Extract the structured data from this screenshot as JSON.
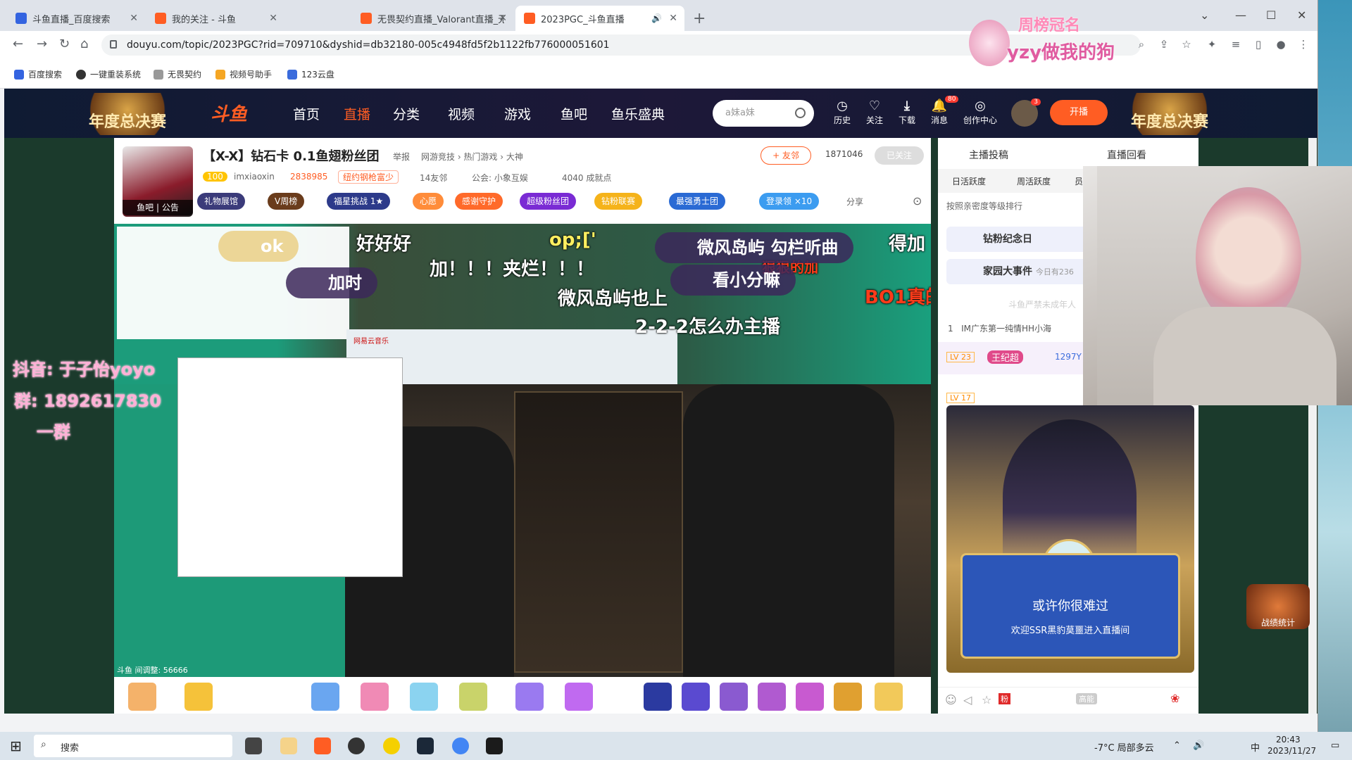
{
  "browser": {
    "tabs": [
      {
        "title": "斗鱼直播_百度搜索",
        "fav": "#3464e0"
      },
      {
        "title": "我的关注 - 斗鱼",
        "fav": "#ff5d23"
      },
      {
        "title": "无畏契约直播_Valorant直播_无",
        "fav": "#ff5d23"
      },
      {
        "title": "2023PGC_斗鱼直播",
        "fav": "#ff5d23"
      }
    ],
    "new_tab": "+",
    "url": "douyu.com/topic/2023PGC?rid=709710&dyshid=db32180-005c4948fd5f2b1122fb776000051601",
    "bookmarks": [
      "百度搜索",
      "一键重装系统",
      "无畏契约",
      "视频号助手",
      "123云盘"
    ],
    "overlay_text": "yzy做我的狗",
    "overlay_top": "周榜冠名"
  },
  "header": {
    "logo": "斗鱼",
    "nav": [
      "首页",
      "直播",
      "分类",
      "视频",
      "游戏",
      "鱼吧",
      "鱼乐盛典"
    ],
    "search_placeholder": "a妹a妹",
    "icons": [
      {
        "label": "历史",
        "glyph": "◷"
      },
      {
        "label": "关注",
        "glyph": "♡"
      },
      {
        "label": "下载",
        "glyph": "⤓"
      },
      {
        "label": "消息",
        "glyph": "🔔"
      },
      {
        "label": "创作中心",
        "glyph": "◎"
      }
    ],
    "msg_count": "80",
    "avatar_count": "3",
    "start_live": "开播",
    "banner": "年度总决赛"
  },
  "room": {
    "title": "【X-X】钻石卡 0.1鱼翅粉丝团",
    "report": "举报",
    "category": "网游竞技 › 热门游戏 › 大神",
    "level": "100",
    "streamer": "imxiaoxin",
    "heat": "2838985",
    "badge": "纽约钢枪富少",
    "friends": "14友邻",
    "guild": "公会: 小象互娱",
    "achievements": "4040 成就点",
    "follow": "+ 友邻",
    "follow_count": "1871046",
    "followed": "已关注",
    "fishbar": "鱼吧 | 公告",
    "tags": [
      "礼物展馆",
      "V周榜",
      "福星挑战 1★",
      "心愿",
      "感谢守护",
      "超级粉丝团",
      "钻粉联赛",
      "最强勇士团"
    ],
    "login_reward": "登录领",
    "reward_count": "×10",
    "share": "分享"
  },
  "video": {
    "danmu": [
      "好好好",
      "op;['",
      "加！！！夹烂！！！",
      "微风岛屿也上",
      "2-2-2怎么办主播",
      "BO1真的",
      "得加",
      "狠狠的加"
    ],
    "pills": [
      {
        "text": "ok",
        "style": "y"
      },
      {
        "text": "加时",
        "style": ""
      },
      {
        "text": "微风岛屿 勾栏听曲",
        "style": ""
      },
      {
        "text": "看小分嘛",
        "style": ""
      }
    ],
    "bottom_info": "斗鱼 间调整: 56666",
    "music": "网易云音乐"
  },
  "overlay_left": [
    "抖音: 于子怡yoyo",
    "群: 1892617830",
    "一群"
  ],
  "right": {
    "tabs": [
      "主播投稿",
      "直播回看"
    ],
    "subtabs": [
      "日活跃度",
      "周活跃度",
      "员"
    ],
    "rank_hint": "按照亲密度等级排行",
    "items": [
      {
        "text": "钻粉纪念日",
        "sub": ""
      },
      {
        "text": "家园大事件",
        "sub": "今日有236"
      }
    ],
    "minor": "斗鱼严禁未成年人",
    "rank1": {
      "no": "1",
      "text": "IM广东第一纯情HH小海"
    },
    "lv23": "LV 23",
    "lv23_name": "王纪超",
    "lv23_id": "1297Y",
    "lv17": "LV 17",
    "notice_title": "或许你很难过",
    "notice_text": "欢迎SSR黑豹莫噩进入直播间",
    "fan_btn": "粉",
    "highlight": "高能"
  },
  "taskbar": {
    "search": "搜索",
    "weather": "-7°C 局部多云",
    "ime": "中",
    "time": "20:43",
    "date": "2023/11/27"
  }
}
